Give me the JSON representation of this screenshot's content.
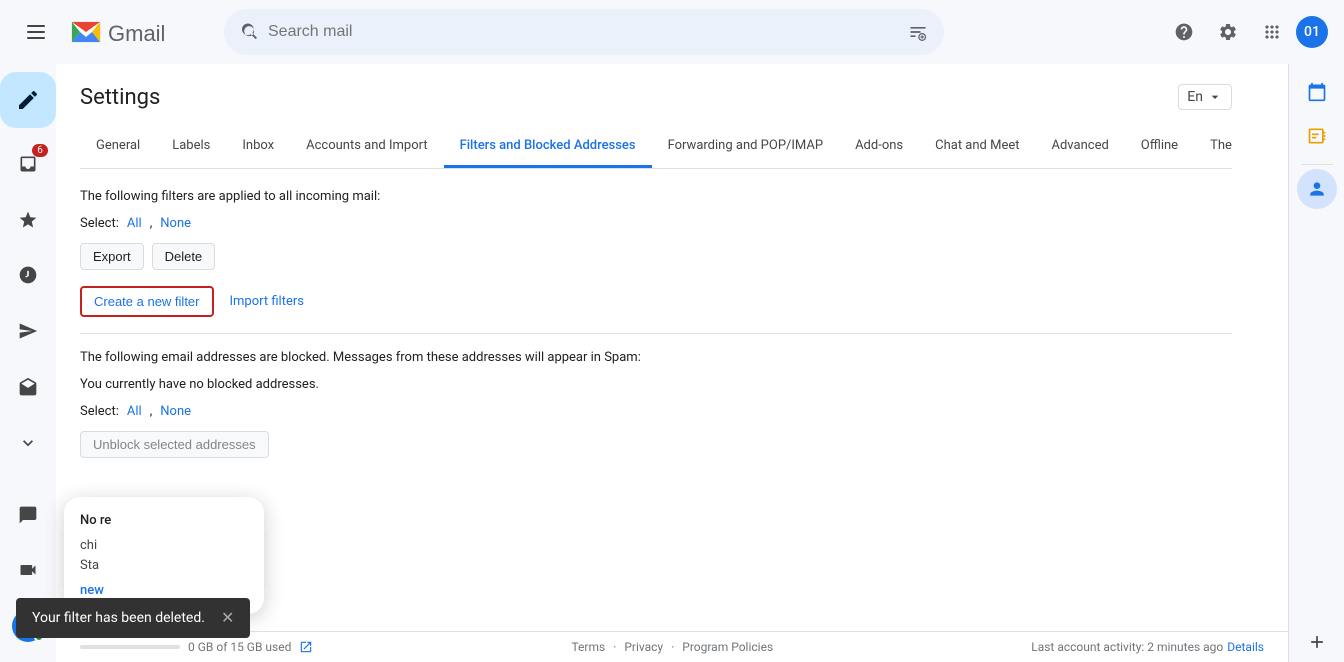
{
  "app": {
    "title": "Gmail",
    "search_placeholder": "Search mail"
  },
  "topbar": {
    "lang_label": "En",
    "avatar_initials": "01"
  },
  "sidebar": {
    "compose_label": "Compose",
    "badge_count": "6",
    "items": [
      {
        "id": "mail",
        "label": "Mail",
        "active": false
      },
      {
        "id": "starred",
        "label": "Starred",
        "active": false
      },
      {
        "id": "snoozed",
        "label": "Snoozed",
        "active": false
      },
      {
        "id": "sent",
        "label": "Sent",
        "active": false
      },
      {
        "id": "drafts",
        "label": "Drafts",
        "active": false
      },
      {
        "id": "chat",
        "label": "Chat",
        "active": false
      },
      {
        "id": "meet",
        "label": "Meet",
        "active": false
      }
    ]
  },
  "settings": {
    "title": "Settings",
    "tabs": [
      {
        "id": "general",
        "label": "General",
        "active": false
      },
      {
        "id": "labels",
        "label": "Labels",
        "active": false
      },
      {
        "id": "inbox",
        "label": "Inbox",
        "active": false
      },
      {
        "id": "accounts",
        "label": "Accounts and Import",
        "active": false
      },
      {
        "id": "filters",
        "label": "Filters and Blocked Addresses",
        "active": true
      },
      {
        "id": "forwarding",
        "label": "Forwarding and POP/IMAP",
        "active": false
      },
      {
        "id": "addons",
        "label": "Add-ons",
        "active": false
      },
      {
        "id": "chat",
        "label": "Chat and Meet",
        "active": false
      },
      {
        "id": "advanced",
        "label": "Advanced",
        "active": false
      },
      {
        "id": "offline",
        "label": "Offline",
        "active": false
      },
      {
        "id": "themes",
        "label": "Themes",
        "active": false
      }
    ],
    "filters_section": {
      "intro_text": "The following filters are applied to all incoming mail:",
      "select_label": "Select:",
      "select_all": "All",
      "select_none": "None",
      "export_btn": "Export",
      "delete_btn": "Delete",
      "create_filter_btn": "Create a new filter",
      "import_filters_link": "Import filters"
    },
    "blocked_section": {
      "desc": "The following email addresses are blocked. Messages from these addresses will appear in Spam:",
      "no_blocked": "You currently have no blocked addresses.",
      "select_label": "Select:",
      "select_all": "All",
      "select_none": "None",
      "unblock_btn": "Unblock selected addresses"
    }
  },
  "footer": {
    "storage_text": "0 GB of 15 GB used",
    "terms": "Terms",
    "privacy": "Privacy",
    "program_policies": "Program Policies",
    "last_activity": "Last account activity: 2 minutes ago",
    "details": "Details"
  },
  "snackbar": {
    "message": "Your filter has been deleted."
  },
  "chat_popup": {
    "title": "No re",
    "text": "ch\nchi\nSta\nnew"
  },
  "right_panel": {
    "icons": [
      "calendar",
      "tasks",
      "contacts",
      "keep",
      "apps"
    ]
  }
}
